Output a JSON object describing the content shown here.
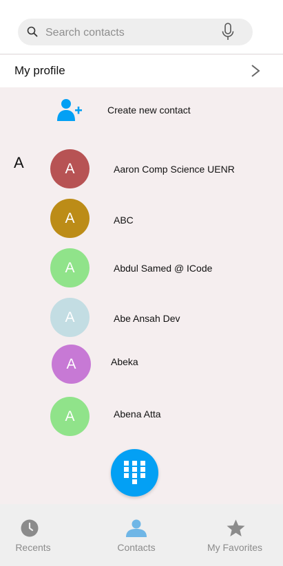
{
  "search": {
    "placeholder": "Search contacts"
  },
  "profile": {
    "label": "My profile"
  },
  "create_contact": {
    "label": "Create new contact"
  },
  "section_letter": "A",
  "contacts": [
    {
      "initial": "A",
      "name": "Aaron Comp Science UENR",
      "color": "#b75354"
    },
    {
      "initial": "A",
      "name": "ABC",
      "color": "#bc8c17"
    },
    {
      "initial": "A",
      "name": "Abdul Samed @ ICode",
      "color": "#90e38a"
    },
    {
      "initial": "A",
      "name": "Abe Ansah Dev",
      "color": "#c3dde3"
    },
    {
      "initial": "A",
      "name": "Abeka",
      "color": "#c779d5"
    },
    {
      "initial": "A",
      "name": "Abena Atta",
      "color": "#90e38a"
    }
  ],
  "bottom_nav": {
    "recents": "Recents",
    "contacts": "Contacts",
    "favorites": "My Favorites"
  },
  "colors": {
    "accent": "#03a0f4",
    "background": "#f5eeef"
  }
}
